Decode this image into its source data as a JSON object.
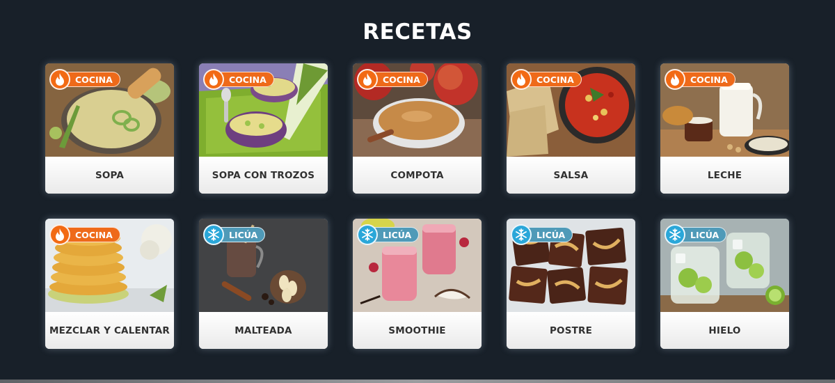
{
  "page": {
    "title": "RECETAS"
  },
  "badges": {
    "cook": {
      "label": "COCINA",
      "icon": "flame-icon",
      "color": "#f26a14"
    },
    "blend": {
      "label": "LICÚA",
      "icon": "snowflake-icon",
      "color": "#2aa7d9"
    }
  },
  "recipes": [
    {
      "id": "sopa",
      "label": "SOPA",
      "mode": "cook"
    },
    {
      "id": "sopa-con-trozos",
      "label": "SOPA CON TROZOS",
      "mode": "cook"
    },
    {
      "id": "compota",
      "label": "COMPOTA",
      "mode": "cook"
    },
    {
      "id": "salsa",
      "label": "SALSA",
      "mode": "cook"
    },
    {
      "id": "leche",
      "label": "LECHE",
      "mode": "cook"
    },
    {
      "id": "mezclar-y-calentar",
      "label": "MEZCLAR Y CALENTAR",
      "mode": "cook"
    },
    {
      "id": "malteada",
      "label": "MALTEADA",
      "mode": "blend"
    },
    {
      "id": "smoothie",
      "label": "SMOOTHIE",
      "mode": "blend"
    },
    {
      "id": "postre",
      "label": "POSTRE",
      "mode": "blend"
    },
    {
      "id": "hielo",
      "label": "HIELO",
      "mode": "blend"
    }
  ]
}
